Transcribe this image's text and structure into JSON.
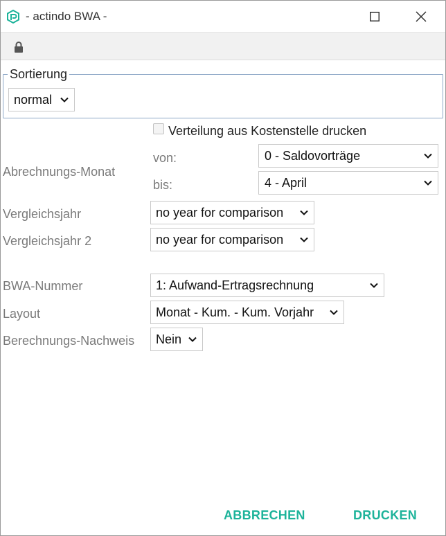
{
  "window": {
    "title": "- actindo BWA -"
  },
  "sortierung": {
    "legend": "Sortierung",
    "value": "normal"
  },
  "verteilung": {
    "label": "Verteilung aus Kostenstelle drucken",
    "checked": false
  },
  "abrechnungs_monat": {
    "label": "Abrechnungs-Monat",
    "von_label": "von:",
    "von_value": "0 - Saldovorträge",
    "bis_label": "bis:",
    "bis_value": "4 - April"
  },
  "vergleichsjahr": {
    "label": "Vergleichsjahr",
    "value": "no year for comparison"
  },
  "vergleichsjahr2": {
    "label": "Vergleichsjahr 2",
    "value": "no year for comparison"
  },
  "bwa_nummer": {
    "label": "BWA-Nummer",
    "value": "1: Aufwand-Ertragsrechnung"
  },
  "layout": {
    "label": "Layout",
    "value": "Monat - Kum. - Kum. Vorjahr"
  },
  "berechnungs_nachweis": {
    "label": "Berechnungs-Nachweis",
    "value": "Nein"
  },
  "footer": {
    "cancel_label": "ABBRECHEN",
    "print_label": "DRUCKEN"
  },
  "colors": {
    "accent": "#1db39a",
    "fieldset_border": "#8da7c6"
  }
}
